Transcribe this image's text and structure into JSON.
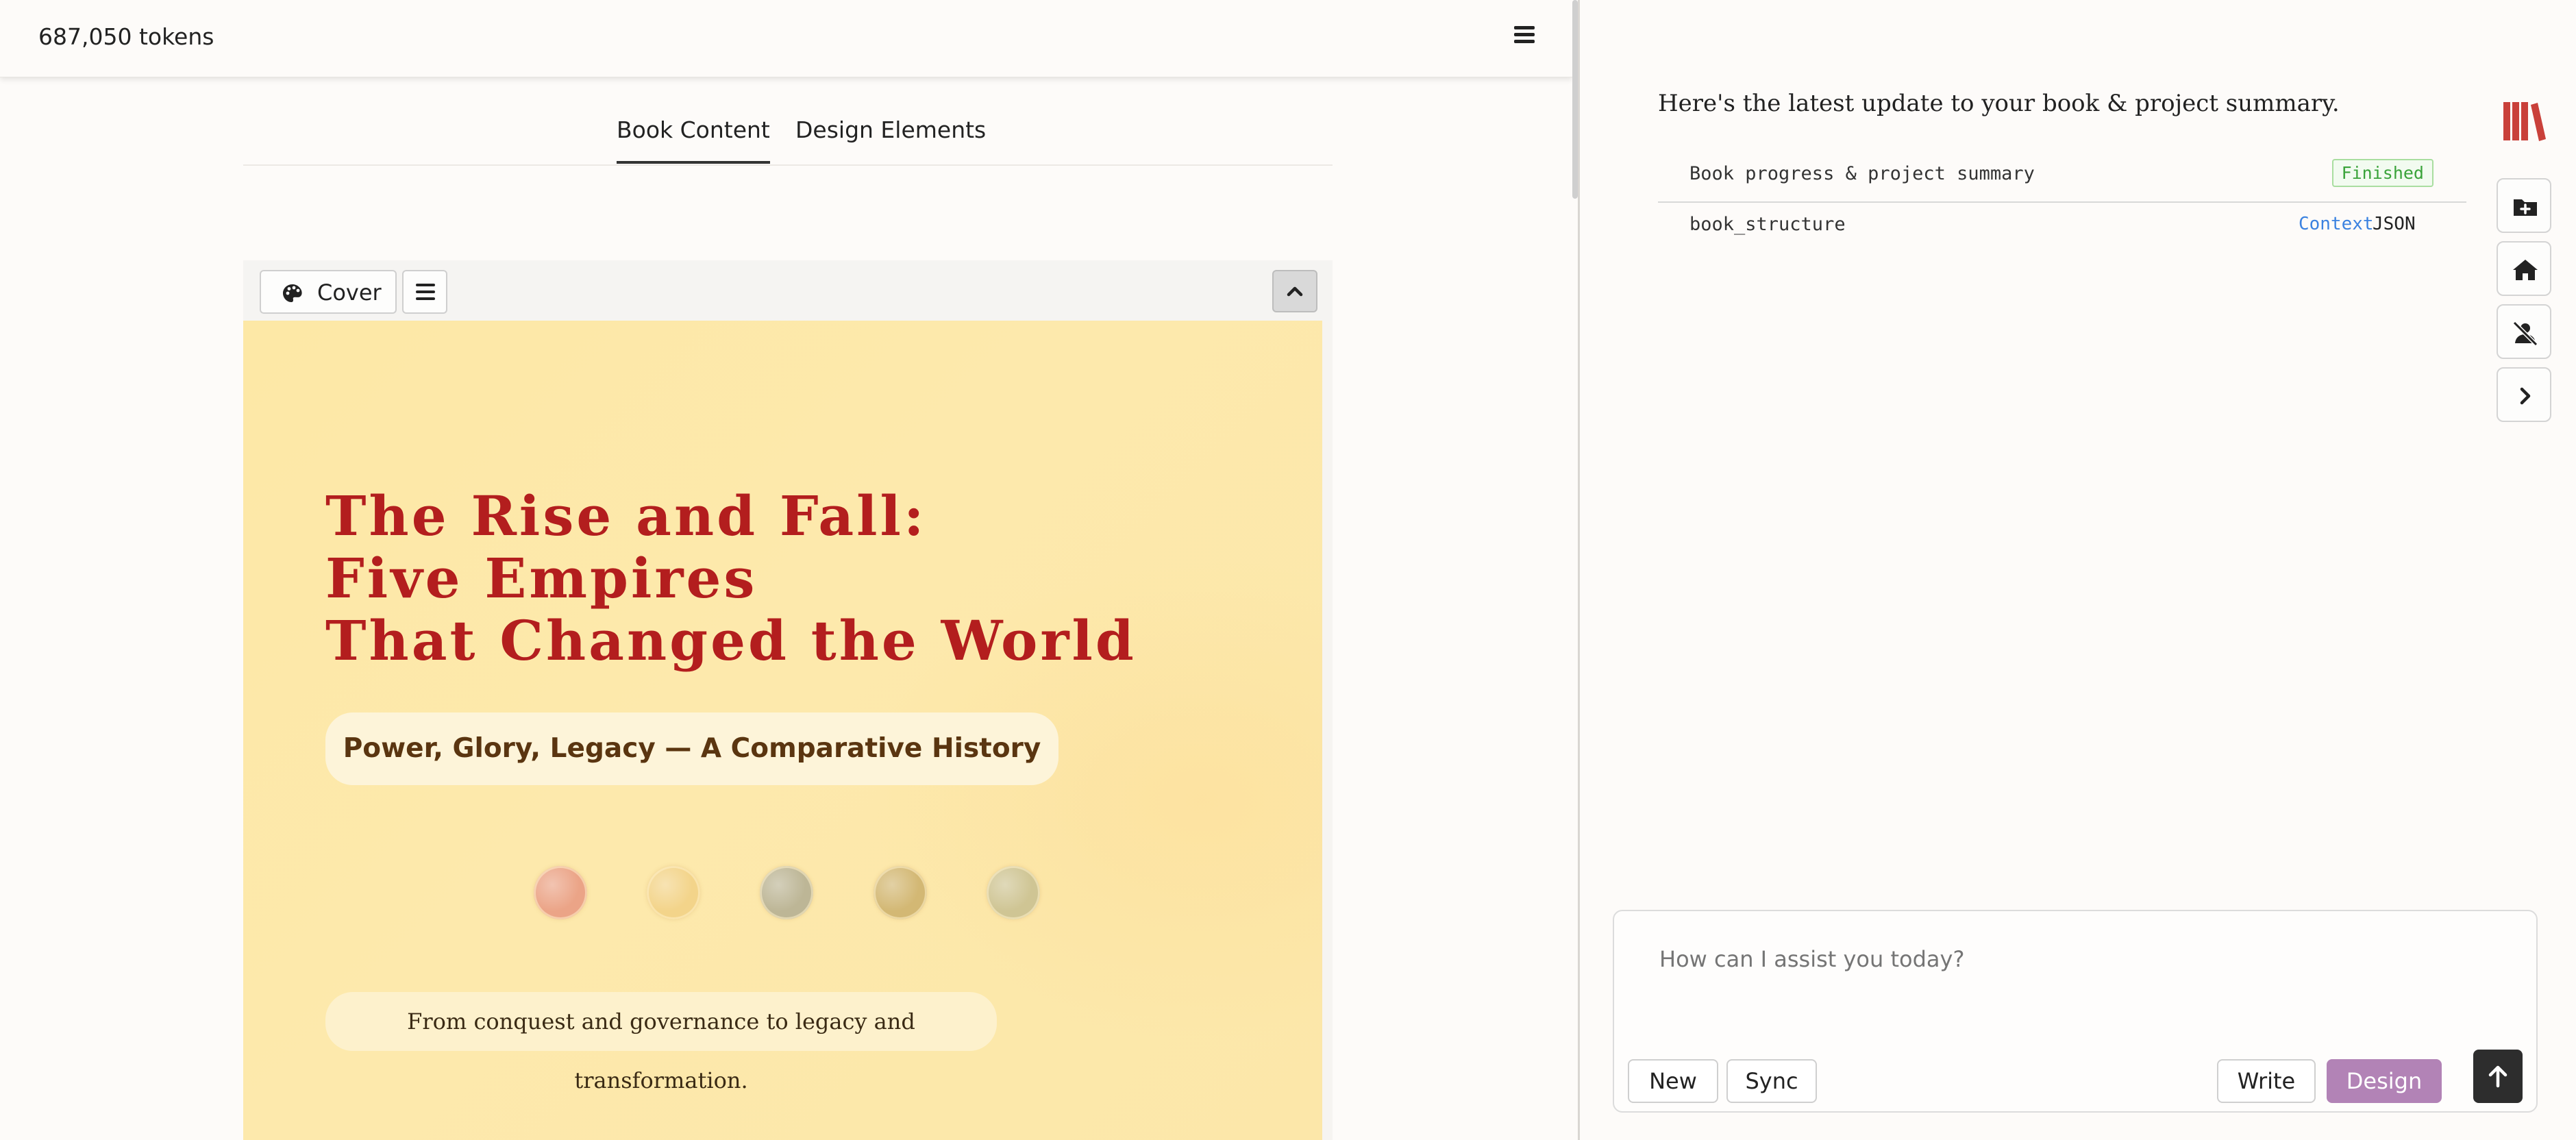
{
  "header": {
    "token_count": "687,050 tokens"
  },
  "tabs": [
    {
      "label": "Book Content"
    },
    {
      "label": "Design Elements"
    }
  ],
  "preview": {
    "toolbar": {
      "cover_label": "Cover"
    },
    "cover": {
      "title_lines": [
        "The Rise and Fall:",
        "Five Empires",
        "That Changed the World"
      ],
      "subtitle": "Power, Glory, Legacy — A Comparative History",
      "tagline": "From conquest and governance to legacy and transformation.",
      "coin_colors": [
        "#eba487",
        "#f3d48a",
        "#bdb696",
        "#d3b874",
        "#cfc594"
      ]
    }
  },
  "chat": {
    "intro": "Here's the latest update to your book & project summary.",
    "summary_label": "Book progress & project summary",
    "summary_status": "Finished",
    "structure_label": "book_structure",
    "context_link": "Context",
    "json_link": "JSON"
  },
  "composer": {
    "placeholder": "How can I assist you today?",
    "new_label": "New",
    "sync_label": "Sync",
    "write_label": "Write",
    "design_label": "Design"
  },
  "colors": {
    "accent": "#b283b6",
    "title_red": "#b31e1e",
    "link_blue": "#3b82e0"
  },
  "icons": [
    "hamburger-icon",
    "palette-icon",
    "chevron-up-icon",
    "books-logo-icon",
    "folder-plus-icon",
    "home-icon",
    "user-slash-icon",
    "chevron-right-icon",
    "arrow-up-icon"
  ]
}
